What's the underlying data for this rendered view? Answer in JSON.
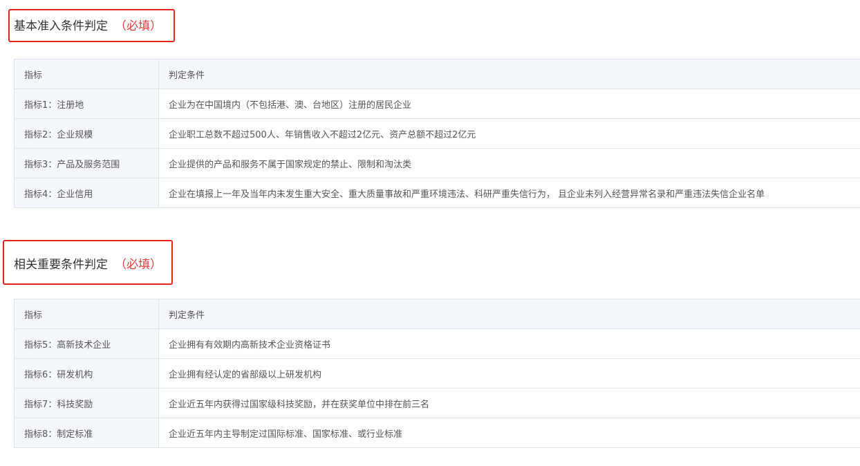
{
  "section1": {
    "title": "基本准入条件判定",
    "required": "（必填）",
    "header": {
      "indicator": "指标",
      "condition": "判定条件"
    },
    "rows": [
      {
        "indicator": "指标1：注册地",
        "condition": "企业为在中国境内（不包括港、澳、台地区）注册的居民企业"
      },
      {
        "indicator": "指标2：企业规模",
        "condition": "企业职工总数不超过500人、年销售收入不超过2亿元、资产总额不超过2亿元"
      },
      {
        "indicator": "指标3：产品及服务范围",
        "condition": "企业提供的产品和服务不属于国家规定的禁止、限制和淘汰类"
      },
      {
        "indicator": "指标4：企业信用",
        "condition": "企业在填报上一年及当年内未发生重大安全、重大质量事故和严重环境违法、科研严重失信行为， 且企业未列入经营异常名录和严重违法失信企业名单"
      }
    ]
  },
  "section2": {
    "title": "相关重要条件判定",
    "required": "（必填）",
    "header": {
      "indicator": "指标",
      "condition": "判定条件"
    },
    "rows": [
      {
        "indicator": "指标5：高新技术企业",
        "condition": "企业拥有有效期内高新技术企业资格证书"
      },
      {
        "indicator": "指标6：研发机构",
        "condition": "企业拥有经认定的省部级以上研发机构"
      },
      {
        "indicator": "指标7：科技奖励",
        "condition": "企业近五年内获得过国家级科技奖励，并在获奖单位中排在前三名"
      },
      {
        "indicator": "指标8：制定标准",
        "condition": "企业近五年内主导制定过国际标准、国家标准、或行业标准"
      }
    ]
  },
  "colors": {
    "highlight": "#e3221b",
    "required_text": "#e4393c",
    "table_border": "#dfe4eb",
    "key_background": "#f4f8fc"
  }
}
